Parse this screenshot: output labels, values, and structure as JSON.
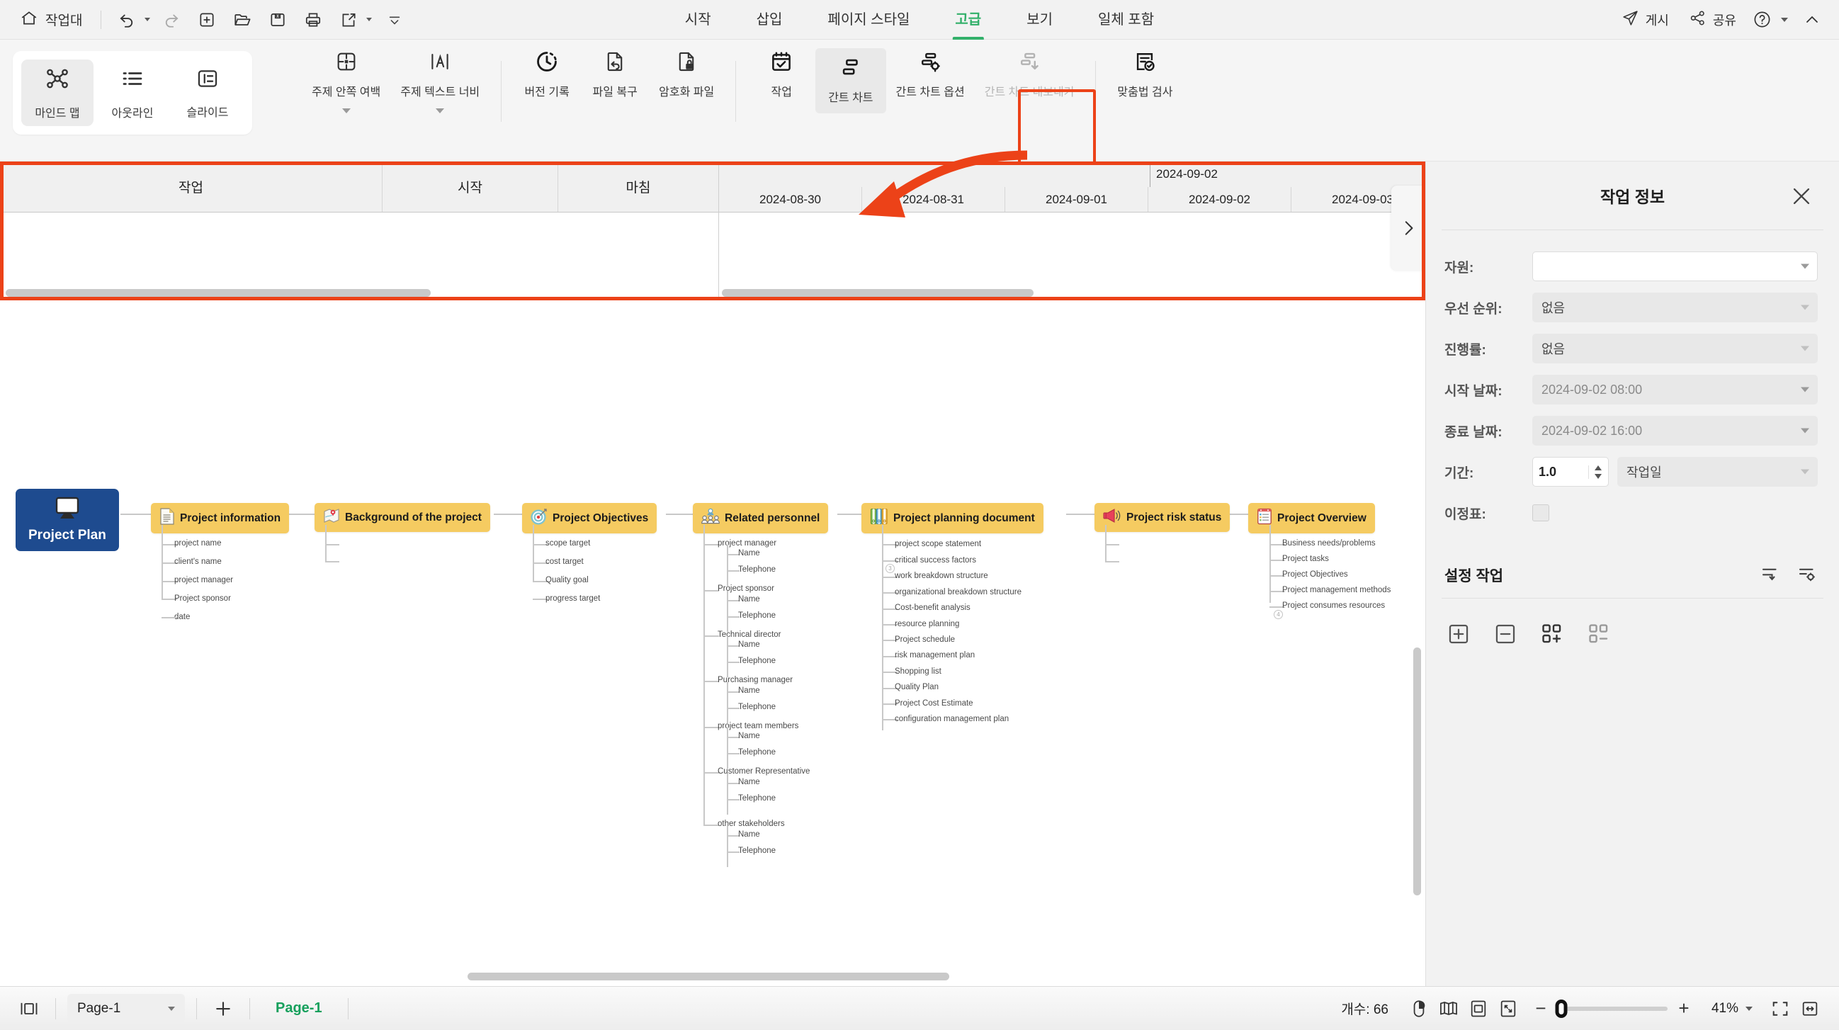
{
  "topbar": {
    "home_label": "작업대",
    "tools": [
      "undo-icon",
      "redo-icon",
      "new-icon",
      "open-icon",
      "save-icon",
      "print-icon",
      "export-icon",
      "more-icon"
    ],
    "tabs": [
      {
        "label": "시작",
        "active": false
      },
      {
        "label": "삽입",
        "active": false
      },
      {
        "label": "페이지 스타일",
        "active": false
      },
      {
        "label": "고급",
        "active": true
      },
      {
        "label": "보기",
        "active": false
      },
      {
        "label": "일체 포함",
        "active": false
      }
    ],
    "publish_label": "게시",
    "share_label": "공유"
  },
  "ribbon": {
    "views": [
      {
        "label": "마인드 맵",
        "icon": "mindmap-icon",
        "active": true
      },
      {
        "label": "아웃라인",
        "icon": "outline-icon",
        "active": false
      },
      {
        "label": "슬라이드",
        "icon": "slide-icon",
        "active": false
      }
    ],
    "items": [
      {
        "label": "주제 안쪽 여백",
        "icon": "topic-padding-icon",
        "dropdown": true,
        "disabled": false,
        "highlight": false
      },
      {
        "label": "주제 텍스트 너비",
        "icon": "topic-text-width-icon",
        "dropdown": true,
        "disabled": false,
        "highlight": false
      },
      {
        "label": "버전 기록",
        "icon": "version-history-icon",
        "dropdown": false,
        "disabled": false,
        "highlight": false
      },
      {
        "label": "파일 복구",
        "icon": "file-recovery-icon",
        "dropdown": false,
        "disabled": false,
        "highlight": false
      },
      {
        "label": "암호화 파일",
        "icon": "encrypt-file-icon",
        "dropdown": false,
        "disabled": false,
        "highlight": false
      },
      {
        "label": "작업",
        "icon": "task-icon",
        "dropdown": false,
        "disabled": false,
        "highlight": false
      },
      {
        "label": "간트 차트",
        "icon": "gantt-chart-icon",
        "dropdown": false,
        "disabled": false,
        "highlight": true
      },
      {
        "label": "간트 차트 옵션",
        "icon": "gantt-options-icon",
        "dropdown": false,
        "disabled": false,
        "highlight": false
      },
      {
        "label": "간트 차트 내보내기",
        "icon": "gantt-export-icon",
        "dropdown": false,
        "disabled": true,
        "highlight": false
      },
      {
        "label": "맞춤법 검사",
        "icon": "spellcheck-icon",
        "dropdown": false,
        "disabled": false,
        "highlight": false
      }
    ]
  },
  "gantt": {
    "columns": [
      "작업",
      "시작",
      "마침"
    ],
    "month_label": "2024-09-02",
    "days": [
      "2024-08-30",
      "2024-08-31",
      "2024-09-01",
      "2024-09-02",
      "2024-09-03"
    ],
    "rows": [],
    "next_icon": "chevron-right-icon",
    "highlight_color": "#EC4218"
  },
  "mindmap": {
    "root": {
      "label": "Project Plan",
      "icon": "monitor-icon",
      "color": "#1E4B8F"
    },
    "branches": [
      {
        "label": "Project information",
        "icon": "document-icon",
        "children": [
          "project name",
          "client's name",
          "project manager",
          "Project sponsor",
          "date"
        ]
      },
      {
        "label": "Background of the project",
        "icon": "map-pin-icon",
        "children": [
          "",
          ""
        ]
      },
      {
        "label": "Project Objectives",
        "icon": "target-icon",
        "children": [
          "scope target",
          "cost target",
          "Quality goal",
          "progress target"
        ]
      },
      {
        "label": "Related personnel",
        "icon": "people-icon",
        "children": [
          "project manager",
          "Name",
          "Telephone",
          "Project sponsor",
          "Name",
          "Telephone",
          "Technical director",
          "Name",
          "Telephone",
          "Purchasing manager",
          "Name",
          "Telephone",
          "project team members",
          "Name",
          "Telephone",
          "Customer Representative",
          "Name",
          "Telephone",
          "other stakeholders",
          "Name",
          "Telephone"
        ]
      },
      {
        "label": "Project planning document",
        "icon": "binders-icon",
        "children": [
          "project scope statement",
          "critical success factors",
          "work breakdown structure",
          "organizational breakdown structure",
          "Cost-benefit analysis",
          "resource planning",
          "Project schedule",
          "risk management plan",
          "Shopping list",
          "Quality Plan",
          "Project Cost Estimate",
          "configuration management plan"
        ]
      },
      {
        "label": "Project risk status",
        "icon": "megaphone-icon",
        "children": [
          "",
          ""
        ]
      },
      {
        "label": "Project Overview",
        "icon": "clipboard-icon",
        "children": [
          "Business needs/problems",
          "Project tasks",
          "Project Objectives",
          "Project management methods",
          "Project consumes resources"
        ]
      }
    ],
    "badges": [
      "3",
      "4"
    ]
  },
  "task_panel": {
    "title": "작업 정보",
    "close_icon": "close-icon",
    "fields": [
      {
        "label": "자원:",
        "value": "",
        "style": "white",
        "caret": true
      },
      {
        "label": "우선 순위:",
        "value": "없음",
        "style": "grey",
        "caret": true
      },
      {
        "label": "진행률:",
        "value": "없음",
        "style": "grey",
        "caret": true
      },
      {
        "label": "시작 날짜:",
        "value": "2024-09-02  08:00",
        "style": "grey",
        "caret": true
      },
      {
        "label": "종료 날짜:",
        "value": "2024-09-02  16:00",
        "style": "grey",
        "caret": true
      }
    ],
    "duration": {
      "label": "기간:",
      "value": "1.0",
      "unit": "작업일"
    },
    "milestone": {
      "label": "이정표:",
      "checked": false
    },
    "section_title": "설정 작업",
    "section_icons": [
      "link-task-icon",
      "task-settings-icon"
    ],
    "action_icons": [
      "add-task-icon",
      "remove-task-icon",
      "add-subtask-icon",
      "remove-subtask-icon"
    ]
  },
  "status_bar": {
    "layout_icon": "panel-layout-icon",
    "page_select": "Page-1",
    "add_page_icon": "plus-icon",
    "page_tab": "Page-1",
    "count_label": "개수: 66",
    "icons": [
      "mouse-mode-icon",
      "book-view-icon",
      "fit-page-icon",
      "full-screen-fit-icon"
    ],
    "zoom_minus": "−",
    "zoom_plus": "+",
    "zoom_value": "41%",
    "presentation_icon": "presentation-icon",
    "width-fit-icon": "width-fit-icon"
  }
}
